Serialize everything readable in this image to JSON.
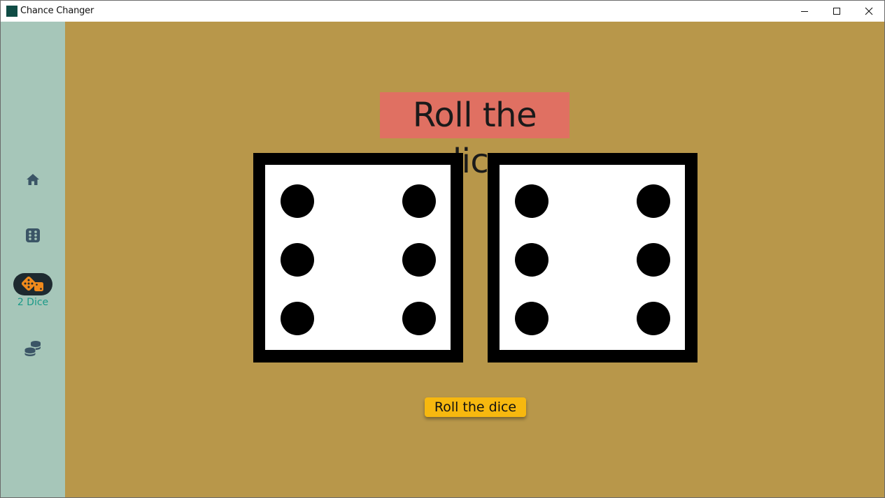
{
  "window": {
    "title": "Chance Changer",
    "controls": {
      "minimize": "minimize-icon",
      "maximize": "maximize-icon",
      "close": "close-icon"
    }
  },
  "sidebar": {
    "items": [
      {
        "icon": "home-icon",
        "label": ""
      },
      {
        "icon": "dice-six-icon",
        "label": ""
      },
      {
        "icon": "two-dice-icon",
        "label": "2 Dice",
        "active": true
      },
      {
        "icon": "coins-icon",
        "label": ""
      }
    ]
  },
  "main": {
    "heading": "Roll the dice",
    "dice": [
      {
        "value": 6
      },
      {
        "value": 6
      }
    ],
    "roll_button": "Roll the dice"
  },
  "colors": {
    "sidebar_bg": "#a6c6b9",
    "main_bg": "#b8974a",
    "heading_bg": "#e07062",
    "button_bg": "#f7b80f",
    "active_label": "#1a9a88",
    "active_icon": "#f08a1c"
  }
}
